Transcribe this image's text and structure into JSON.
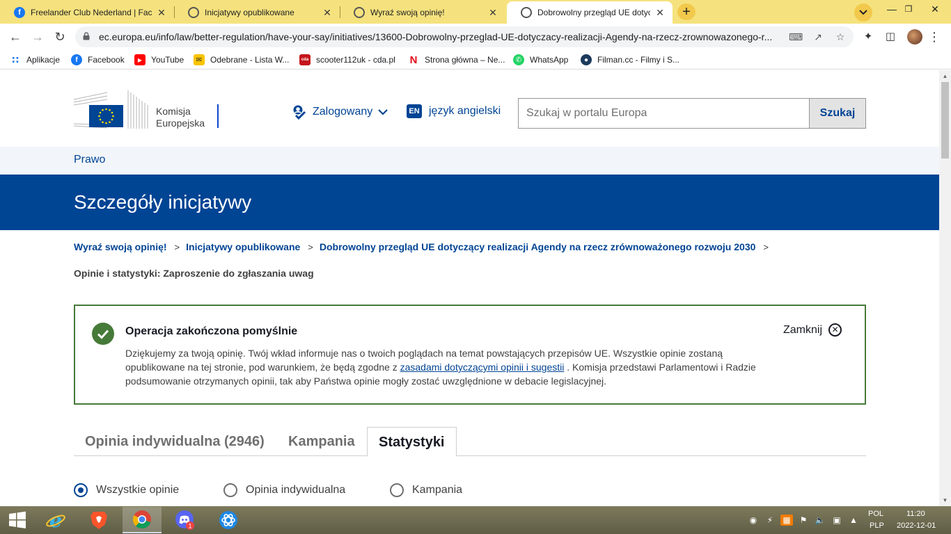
{
  "browser": {
    "tabs": [
      {
        "title": "Freelander Club Nederland | Face",
        "close": "✕"
      },
      {
        "title": "Inicjatywy opublikowane",
        "close": "✕"
      },
      {
        "title": "Wyraź swoją opinię!",
        "close": "✕"
      },
      {
        "title": "Dobrowolny przegląd UE dotycza",
        "close": "✕"
      }
    ],
    "new_tab": "+",
    "url": "ec.europa.eu/info/law/better-regulation/have-your-say/initiatives/13600-Dobrowolny-przeglad-UE-dotyczacy-realizacji-Agendy-na-rzecz-zrownowazonego-r...",
    "bookmarks": [
      "Aplikacje",
      "Facebook",
      "YouTube",
      "Odebrane - Lista W...",
      "scooter112uk - cda.pl",
      "Strona główna – Ne...",
      "WhatsApp",
      "Filman.cc - Filmy i S..."
    ],
    "accent": "#f5e27e"
  },
  "header": {
    "logo_line1": "Komisja",
    "logo_line2": "Europejska",
    "user_menu": "Zalogowany",
    "language_code": "EN",
    "language_label": "język angielski",
    "search_placeholder": "Szukaj w portalu Europa",
    "search_button": "Szukaj"
  },
  "site": {
    "name": "Prawo",
    "page_title": "Szczegóły inicjatywy"
  },
  "breadcrumb": {
    "items": [
      "Wyraź swoją opinię!",
      "Inicjatywy opublikowane",
      "Dobrowolny przegląd UE dotyczący realizacji Agendy na rzecz zrównoważonego rozwoju 2030"
    ],
    "separator": ">",
    "current": "Opinie i statystyki: Zaproszenie do zgłaszania uwag"
  },
  "message": {
    "title": "Operacja zakończona pomyślnie",
    "body_part1": "Dziękujemy za twoją opinię. Twój wkład informuje nas o twoich poglądach na temat powstających przepisów UE. Wszystkie opinie zostaną opublikowane na tej stronie, pod warunkiem, że będą zgodne z",
    "body_link": "zasadami dotyczącymi opinii i sugestii",
    "body_part2": ". Komisja przedstawi Parlamentowi i Radzie podsumowanie otrzymanych opinii, tak aby Państwa opinie mogły zostać uwzględnione w debacie legislacyjnej.",
    "close_label": "Zamknij",
    "color": "#467a39"
  },
  "tabs": [
    "Opinia indywidualna (2946)",
    "Kampania",
    "Statystyki"
  ],
  "filters": {
    "options": [
      "Wszystkie opinie",
      "Opinia indywidualna",
      "Kampania"
    ],
    "selected": "Wszystkie opinie"
  },
  "taskbar": {
    "lang_top": "POL",
    "lang_bottom": "PLP",
    "time": "11:20",
    "date": "2022-12-01",
    "notification_count": "1"
  },
  "colors": {
    "ec_blue": "#004494",
    "success_green": "#467a39"
  }
}
